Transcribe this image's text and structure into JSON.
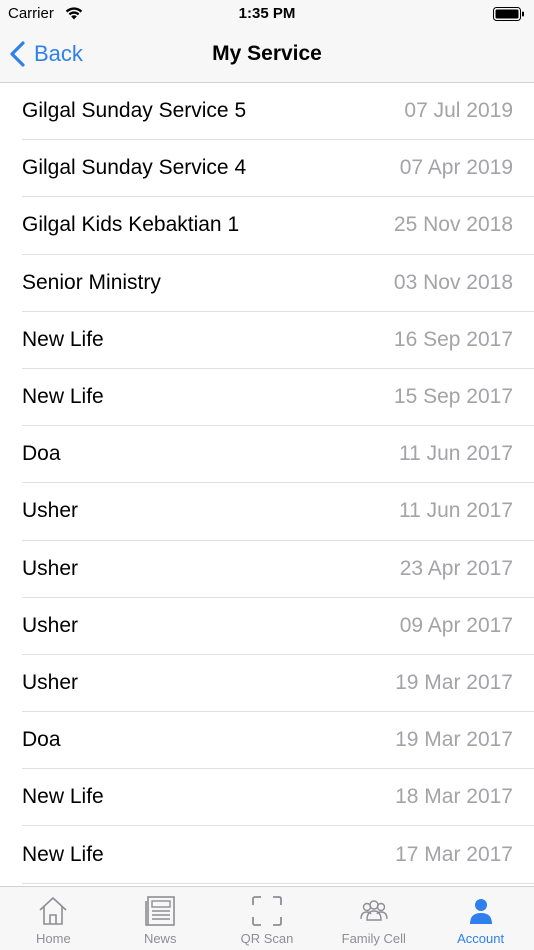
{
  "status_bar": {
    "carrier": "Carrier",
    "time": "1:35 PM",
    "icons": [
      "wifi-icon",
      "battery-icon"
    ]
  },
  "nav": {
    "back_label": "Back",
    "title": "My Service"
  },
  "services": [
    {
      "name": "Gilgal Sunday Service 5",
      "date": "07 Jul 2019"
    },
    {
      "name": "Gilgal Sunday Service 4",
      "date": "07 Apr 2019"
    },
    {
      "name": "Gilgal Kids Kebaktian 1",
      "date": "25 Nov 2018"
    },
    {
      "name": "Senior Ministry",
      "date": "03 Nov 2018"
    },
    {
      "name": "New Life",
      "date": "16 Sep 2017"
    },
    {
      "name": "New Life",
      "date": "15 Sep 2017"
    },
    {
      "name": "Doa",
      "date": "11 Jun 2017"
    },
    {
      "name": "Usher",
      "date": "11 Jun 2017"
    },
    {
      "name": "Usher",
      "date": "23 Apr 2017"
    },
    {
      "name": "Usher",
      "date": "09 Apr 2017"
    },
    {
      "name": "Usher",
      "date": "19 Mar 2017"
    },
    {
      "name": "Doa",
      "date": "19 Mar 2017"
    },
    {
      "name": "New Life",
      "date": "18 Mar 2017"
    },
    {
      "name": "New Life",
      "date": "17 Mar 2017"
    }
  ],
  "tabs": [
    {
      "label": "Home",
      "icon": "home-icon",
      "active": false
    },
    {
      "label": "News",
      "icon": "news-icon",
      "active": false
    },
    {
      "label": "QR Scan",
      "icon": "qr-scan-icon",
      "active": false
    },
    {
      "label": "Family Cell",
      "icon": "family-cell-icon",
      "active": false
    },
    {
      "label": "Account",
      "icon": "account-icon",
      "active": true
    }
  ],
  "colors": {
    "accent": "#2f80ed",
    "inactive": "#8e8e93",
    "date_text": "#a3a3a8",
    "bar_background": "#f7f7f7"
  }
}
